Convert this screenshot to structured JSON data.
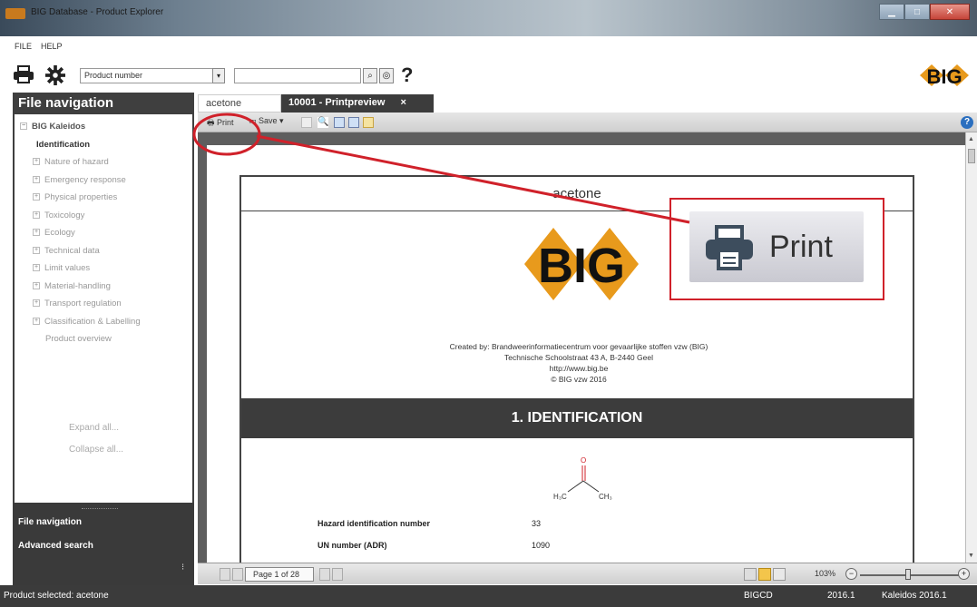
{
  "window": {
    "title": "BIG Database - Product Explorer"
  },
  "menu": {
    "items": [
      "FILE",
      "HELP"
    ]
  },
  "toolbar": {
    "search_type": "Product number",
    "search_value": "",
    "help_label": "?",
    "logo_text": "BIG"
  },
  "sidebar": {
    "header": "File navigation",
    "tree": {
      "root": "BIG Kaleidos",
      "selected": "Identification",
      "items": [
        "Nature of hazard",
        "Emergency response",
        "Physical properties",
        "Toxicology",
        "Ecology",
        "Technical data",
        "Limit values",
        "Material-handling",
        "Transport regulation",
        "Classification & Labelling"
      ],
      "last": "Product overview"
    },
    "expand_all": "Expand all...",
    "collapse_all": "Collapse all...",
    "bottom_links": [
      "File navigation",
      "Advanced search"
    ]
  },
  "tabs": [
    {
      "label": "acetone"
    },
    {
      "label": "10001 - Printpreview",
      "close": "×"
    }
  ],
  "preview_toolbar": {
    "print": "Print",
    "save": "Save"
  },
  "document": {
    "header": "acetone",
    "logo_text": "BIG",
    "created_lines": [
      "Created by: Brandweerinformatiecentrum voor gevaarlijke stoffen vzw (BIG)",
      "Technische Schoolstraat 43 A, B-2440 Geel",
      "http://www.big.be",
      "© BIG vzw 2016"
    ],
    "section_title": "1. IDENTIFICATION",
    "molecule": {
      "o_label": "O",
      "left_label": "H₃C",
      "right_label": "CH₃"
    },
    "rows": [
      {
        "label": "Hazard identification number",
        "value": "33"
      },
      {
        "label": "UN number (ADR)",
        "value": "1090"
      }
    ]
  },
  "callout": {
    "label": "Print"
  },
  "pager": {
    "page": "Page 1 of 28",
    "zoom": "103%"
  },
  "status": {
    "selected": "Product selected: acetone",
    "db": "BIGCD",
    "version": "2016.1",
    "product": "Kaleidos 2016.1"
  },
  "colors": {
    "accent_red": "#d0212a",
    "logo_orange": "#e89a1c",
    "dark_panel": "#3c3c3c"
  }
}
